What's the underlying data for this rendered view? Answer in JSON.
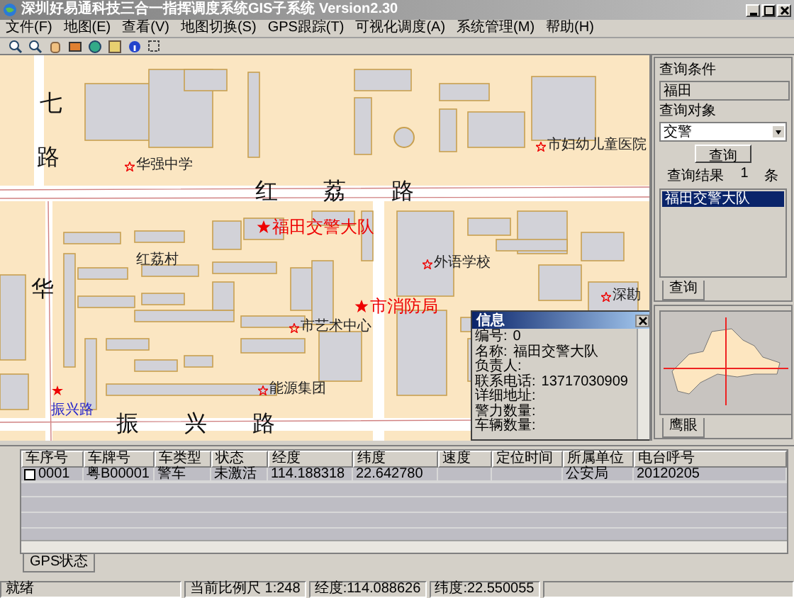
{
  "window": {
    "title": "深圳好易通科技三合一指挥调度系统GIS子系统 Version2.30"
  },
  "menu": [
    "文件(F)",
    "地图(E)",
    "查看(V)",
    "地图切换(S)",
    "GPS跟踪(T)",
    "可视化调度(A)",
    "系统管理(M)",
    "帮助(H)"
  ],
  "map": {
    "labels": [
      {
        "kind": "road",
        "text": "七"
      },
      {
        "kind": "road",
        "text": "路"
      },
      {
        "kind": "poi",
        "text": "华强中学"
      },
      {
        "kind": "poi",
        "text": "市妇幼儿童医院"
      },
      {
        "kind": "road",
        "text": "红荔路"
      },
      {
        "kind": "star",
        "text": "福田交警大队"
      },
      {
        "kind": "area",
        "text": "红荔村"
      },
      {
        "kind": "poi",
        "text": "外语学校"
      },
      {
        "kind": "poi",
        "text": "深勘"
      },
      {
        "kind": "star",
        "text": "市消防局"
      },
      {
        "kind": "poi",
        "text": "市艺术中心"
      },
      {
        "kind": "poi",
        "text": "能源集团"
      },
      {
        "kind": "road",
        "text": "华"
      },
      {
        "kind": "blue",
        "text": "振兴路"
      },
      {
        "kind": "road",
        "text": "振兴路"
      }
    ]
  },
  "info_popup": {
    "title": "信息",
    "fields": [
      {
        "label": "编号:",
        "value": "0"
      },
      {
        "label": "名称:",
        "value": "福田交警大队"
      },
      {
        "label": "负责人:"
      },
      {
        "label": "联系电话:",
        "value": "13717030909"
      },
      {
        "label": "详细地址:"
      },
      {
        "label": "警力数量:"
      },
      {
        "label": "车辆数量:"
      }
    ]
  },
  "query_panel": {
    "condition_label": "查询条件",
    "condition_value": "福田",
    "target_label": "查询对象",
    "target_value": "交警",
    "button": "查询",
    "result_label": "查询结果",
    "result_count": "1",
    "result_unit": "条",
    "results": [
      {
        "text": "福田交警大队",
        "selected": true
      }
    ],
    "tab": "查询"
  },
  "overview_panel": {
    "tab": "鹰眼"
  },
  "gps_table": {
    "columns": [
      "车序号",
      "车牌号",
      "车类型",
      "状态",
      "经度",
      "纬度",
      "速度",
      "定位时间",
      "所属单位",
      "电台呼号"
    ],
    "rows": [
      {
        "checked": false,
        "cells": [
          "0001",
          "粤B00001",
          "警车",
          "未激活",
          "114.188318",
          "22.642780",
          "",
          "",
          "公安局",
          "20120205"
        ]
      }
    ],
    "tab": "GPS状态"
  },
  "status_bar": [
    "就绪",
    "当前比例尺 1:248",
    "经度:114.088626",
    "纬度:22.550055"
  ]
}
